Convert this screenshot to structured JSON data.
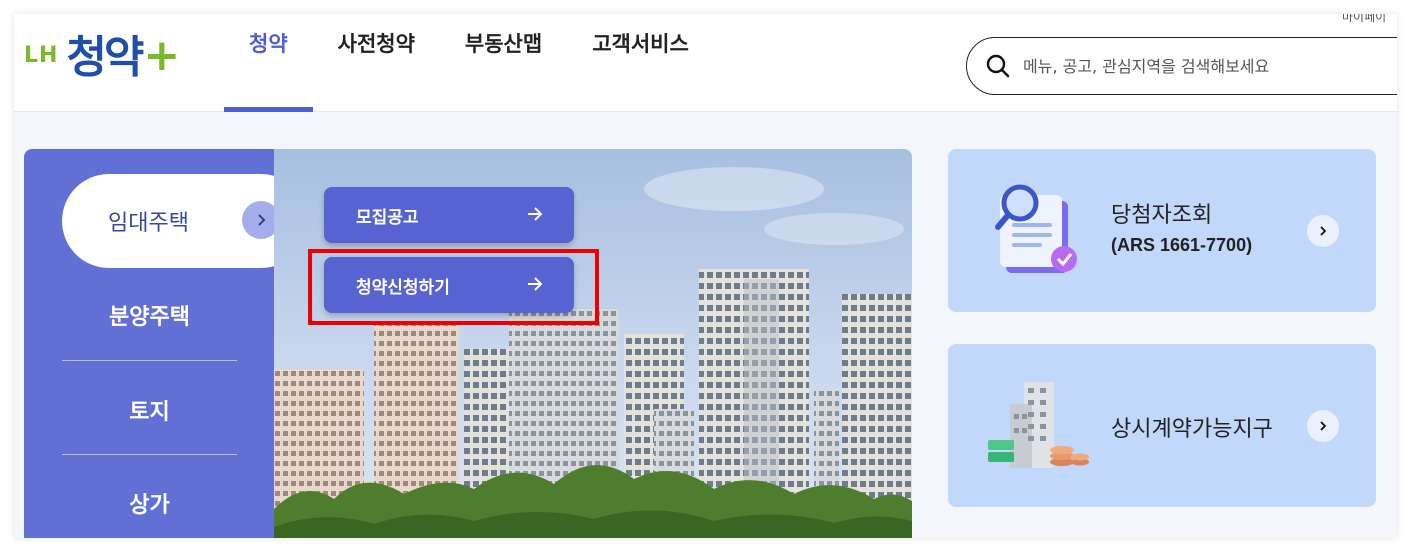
{
  "header": {
    "logo": {
      "prefix": "LH",
      "main": "청약",
      "plus": "+"
    },
    "top_link": "마이페이",
    "nav": [
      {
        "label": "청약",
        "active": true
      },
      {
        "label": "사전청약",
        "active": false
      },
      {
        "label": "부동산맵",
        "active": false
      },
      {
        "label": "고객서비스",
        "active": false
      }
    ],
    "search": {
      "placeholder": "메뉴, 공고, 관심지역을 검색해보세요",
      "icon": "search-icon"
    }
  },
  "left_menu": {
    "active": "임대주택",
    "items": [
      "분양주택",
      "토지",
      "상가"
    ]
  },
  "hero": {
    "buttons": [
      {
        "label": "모집공고",
        "icon": "arrow-right-icon"
      },
      {
        "label": "청약신청하기",
        "icon": "arrow-right-icon",
        "highlighted": true
      }
    ]
  },
  "cards": [
    {
      "title": "당첨자조회",
      "subtitle": "(ARS 1661-7700)",
      "icon": "document-search-icon"
    },
    {
      "title": "상시계약가능지구",
      "subtitle": "",
      "icon": "building-coins-icon"
    }
  ],
  "colors": {
    "brand_blue": "#1f4fa8",
    "brand_green": "#7ab929",
    "accent": "#4e5fd3",
    "menu_bg": "#6270d5",
    "card_bg": "#c2d8fb",
    "highlight": "#ee0000"
  }
}
